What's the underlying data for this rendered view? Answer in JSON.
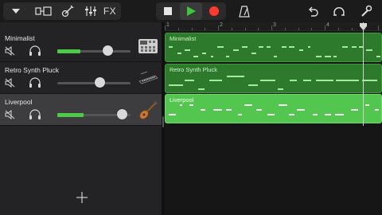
{
  "toolbar": {
    "buttons": [
      {
        "name": "dropdown-button",
        "icon": "chevron-down-icon"
      },
      {
        "name": "view-toggle-button",
        "icon": "tracks-view-icon"
      },
      {
        "name": "instrument-button",
        "icon": "guitar-icon"
      },
      {
        "name": "mixer-button",
        "icon": "mixer-sliders-icon"
      },
      {
        "name": "fx-button",
        "label": "FX"
      },
      {
        "name": "stop-button",
        "icon": "stop-icon"
      },
      {
        "name": "play-button",
        "icon": "play-icon"
      },
      {
        "name": "record-button",
        "icon": "record-icon"
      },
      {
        "name": "metronome-button",
        "icon": "metronome-icon"
      },
      {
        "name": "undo-button",
        "icon": "undo-icon"
      },
      {
        "name": "loop-browser-button",
        "icon": "loop-icon"
      },
      {
        "name": "settings-button",
        "icon": "wrench-icon"
      }
    ],
    "fx_label": "FX"
  },
  "colors": {
    "play": "#3ec63a",
    "record": "#ff3b30",
    "region_dark": "#2e7a2c",
    "region_light": "#53c650",
    "meter": "#4ec94a",
    "selected_header": "#3d3d40"
  },
  "tracks": [
    {
      "name": "Minimalist",
      "instrument_icon": "drum-machine-icon",
      "volume": 0.68,
      "meter_level": 0.32,
      "selected": false
    },
    {
      "name": "Retro Synth Pluck",
      "instrument_icon": "synth-icon",
      "volume": 0.58,
      "meter_level": 0.0,
      "selected": false
    },
    {
      "name": "Liverpool",
      "instrument_icon": "bass-guitar-icon",
      "volume": 0.88,
      "meter_level": 0.36,
      "selected": true
    }
  ],
  "regions": [
    {
      "label": "Minimalist",
      "style": "dark"
    },
    {
      "label": "Retro Synth Pluck",
      "style": "dark"
    },
    {
      "label": "Liverpool",
      "style": "light"
    }
  ],
  "ruler": {
    "bars": [
      "1",
      "2",
      "3",
      "4"
    ]
  },
  "add_track_icon": "plus-icon"
}
